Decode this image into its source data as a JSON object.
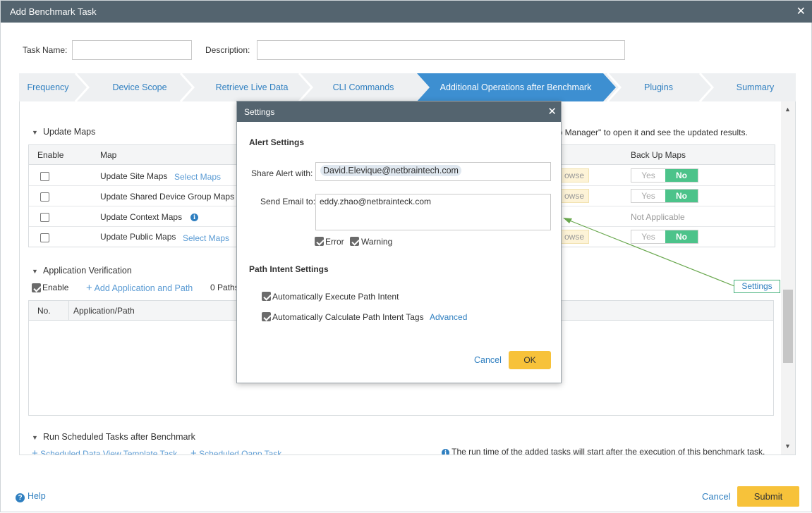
{
  "window": {
    "title": "Add Benchmark Task"
  },
  "form": {
    "task_name_label": "Task Name:",
    "task_name_value": "",
    "description_label": "Description:",
    "description_value": ""
  },
  "steps": [
    {
      "label": "Frequency",
      "active": false
    },
    {
      "label": "Device Scope",
      "active": false
    },
    {
      "label": "Retrieve Live Data",
      "active": false
    },
    {
      "label": "CLI Commands",
      "active": false
    },
    {
      "label": "Additional Operations after Benchmark",
      "active": true
    },
    {
      "label": "Plugins",
      "active": false
    },
    {
      "label": "Summary",
      "active": false
    }
  ],
  "update_maps": {
    "heading": "Update Maps",
    "hint": "e Map Manager\" to open it and see the updated results.",
    "columns": {
      "enable": "Enable",
      "map": "Map",
      "backup": "Back Up Maps"
    },
    "rows": [
      {
        "name": "Update Site Maps",
        "link": "Select Maps",
        "browse": "owse",
        "backup_yes": "Yes",
        "backup_no": "No"
      },
      {
        "name": "Update Shared Device Group Maps",
        "link": "",
        "browse": "owse",
        "backup_yes": "Yes",
        "backup_no": "No"
      },
      {
        "name": "Update Context Maps",
        "link": "",
        "browse": "",
        "backup_text": "Not Applicable"
      },
      {
        "name": "Update Public Maps",
        "link": "Select Maps",
        "browse": "owse",
        "backup_yes": "Yes",
        "backup_no": "No"
      }
    ]
  },
  "app_verification": {
    "heading": "Application Verification",
    "enable_label": "Enable",
    "add_link": "Add Application and Path",
    "paths_count": "0 Paths",
    "columns": {
      "no": "No.",
      "app_path": "Application/Path"
    },
    "settings_button": "Settings"
  },
  "scheduled": {
    "heading": "Run Scheduled Tasks after Benchmark",
    "link1": "Scheduled Data View Template Task",
    "link2": "Scheduled Qapp Task",
    "note": "The run time of the added tasks will start after the execution of this benchmark task."
  },
  "footer": {
    "help": "Help",
    "cancel": "Cancel",
    "submit": "Submit"
  },
  "modal": {
    "title": "Settings",
    "alert_heading": "Alert Settings",
    "share_label": "Share Alert with:",
    "share_value": "David.Elevique@netbraintech.com",
    "email_label": "Send Email to:",
    "email_value": "eddy.zhao@netbrainteck.com",
    "error_label": "Error",
    "warning_label": "Warning",
    "path_heading": "Path Intent Settings",
    "auto_exec_label": "Automatically Execute Path Intent",
    "auto_calc_label": "Automatically Calculate Path Intent Tags",
    "advanced_link": "Advanced",
    "cancel": "Cancel",
    "ok": "OK"
  },
  "colors": {
    "titlebar": "#54646f",
    "active_step": "#3d8fd1",
    "accent_link": "#2f7fc0",
    "toggle_on": "#4cc38a",
    "primary_button": "#f7c23a",
    "pointer_line": "#6aa84f"
  }
}
